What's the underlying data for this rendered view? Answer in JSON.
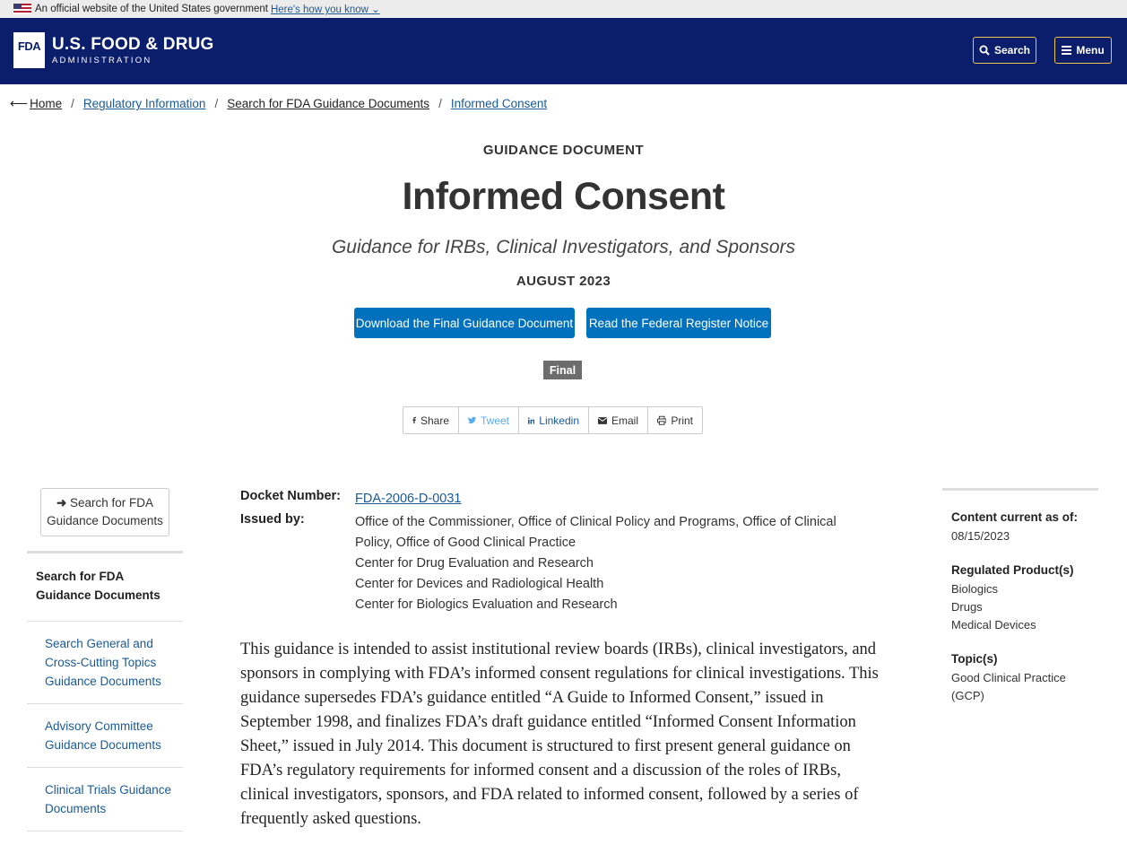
{
  "gov_banner": {
    "text": "An official website of the United States government",
    "link": "Here's how you know"
  },
  "header": {
    "logo_mark": "FDA",
    "logo_line1": "U.S. FOOD & DRUG",
    "logo_line2": "ADMINISTRATION",
    "search_label": "Search",
    "menu_label": "Menu"
  },
  "breadcrumb": {
    "items": [
      "Home",
      "Regulatory Information",
      "Search for FDA Guidance Documents",
      "Informed Consent"
    ],
    "separator": "/"
  },
  "document": {
    "kicker": "GUIDANCE DOCUMENT",
    "title": "Informed Consent",
    "subtitle": "Guidance for IRBs, Clinical Investigators, and Sponsors",
    "date": "AUGUST 2023",
    "download_label": "Download the Final Guidance Document",
    "register_label": "Read the Federal Register Notice",
    "status_badge": "Final"
  },
  "share": {
    "items": [
      "Share",
      "Tweet",
      "Linkedin",
      "Email",
      "Print"
    ]
  },
  "left_nav": {
    "back_button": "Search for FDA Guidance Documents",
    "top_item": "Search for FDA Guidance Documents",
    "items": [
      "Search General and Cross-Cutting Topics Guidance Documents",
      "Advisory Committee Guidance Documents",
      "Clinical Trials Guidance Documents"
    ]
  },
  "meta": {
    "docket_label": "Docket Number:",
    "docket_value": "FDA-2006-D-0031",
    "issued_label": "Issued by:",
    "issued_values": [
      "Office of the Commissioner, Office of Clinical Policy and Programs, Office of Clinical Policy, Office of Good Clinical Practice",
      "Center for Drug Evaluation and Research",
      "Center for Devices and Radiological Health",
      "Center for Biologics Evaluation and Research"
    ]
  },
  "body_text": "This guidance is intended to assist institutional review boards (IRBs), clinical investigators, and sponsors in complying with FDA’s informed consent regulations for clinical investigations. This guidance supersedes FDA’s guidance entitled “A Guide to Informed Consent,” issued in September 1998, and finalizes FDA’s draft guidance entitled “Informed Consent Information Sheet,” issued in July 2014. This document is structured to first present general guidance on FDA’s regulatory requirements for informed consent and a discussion of the roles of IRBs, clinical investigators, sponsors, and FDA related to informed consent, followed by a series of frequently asked questions.",
  "right_sidebar": {
    "content_label": "Content current as of:",
    "content_date": "08/15/2023",
    "products_label": "Regulated Product(s)",
    "products": [
      "Biologics",
      "Drugs",
      "Medical Devices"
    ],
    "topics_label": "Topic(s)",
    "topics": [
      "Good Clinical Practice (GCP)"
    ]
  },
  "colors": {
    "header_bg": "#0b1e6b",
    "accent_yellow": "#f3c44a",
    "button_blue": "#0071bc",
    "link_blue": "#1a5a96",
    "badge_gray": "#6d6d6d"
  }
}
